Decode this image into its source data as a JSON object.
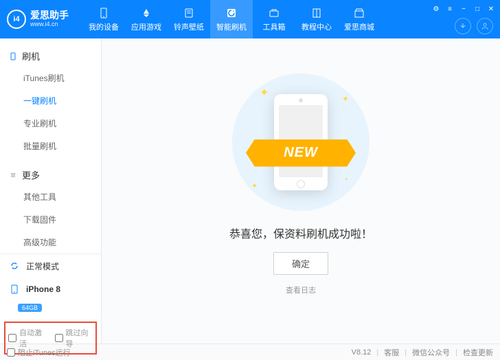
{
  "header": {
    "logo": {
      "name": "爱思助手",
      "url": "www.i4.cn",
      "badge": "i4"
    },
    "nav": [
      {
        "label": "我的设备",
        "icon": "phone-icon"
      },
      {
        "label": "应用游戏",
        "icon": "apps-icon"
      },
      {
        "label": "铃声壁纸",
        "icon": "music-icon"
      },
      {
        "label": "智能刷机",
        "icon": "refresh-icon",
        "active": true
      },
      {
        "label": "工具箱",
        "icon": "toolbox-icon"
      },
      {
        "label": "教程中心",
        "icon": "book-icon"
      },
      {
        "label": "爱思商城",
        "icon": "store-icon"
      }
    ],
    "window_controls": [
      "settings",
      "menu",
      "minimize",
      "maximize",
      "close"
    ]
  },
  "sidebar": {
    "sections": [
      {
        "title": "刷机",
        "icon": "phone",
        "items": [
          {
            "label": "iTunes刷机"
          },
          {
            "label": "一键刷机",
            "active": true
          },
          {
            "label": "专业刷机"
          },
          {
            "label": "批量刷机"
          }
        ]
      },
      {
        "title": "更多",
        "icon": "more",
        "items": [
          {
            "label": "其他工具"
          },
          {
            "label": "下载固件"
          },
          {
            "label": "高级功能"
          }
        ]
      }
    ],
    "mode": {
      "label": "正常模式"
    },
    "device": {
      "name": "iPhone 8",
      "storage": "64GB"
    },
    "opts": {
      "auto_activate": "自动激活",
      "skip_wizard": "跳过向导"
    }
  },
  "main": {
    "ribbon": "NEW",
    "success": "恭喜您，保资料刷机成功啦！",
    "confirm": "确定",
    "log": "查看日志"
  },
  "footer": {
    "block_itunes": "阻止iTunes运行",
    "version": "V8.12",
    "links": [
      "客服",
      "微信公众号",
      "检查更新"
    ]
  }
}
